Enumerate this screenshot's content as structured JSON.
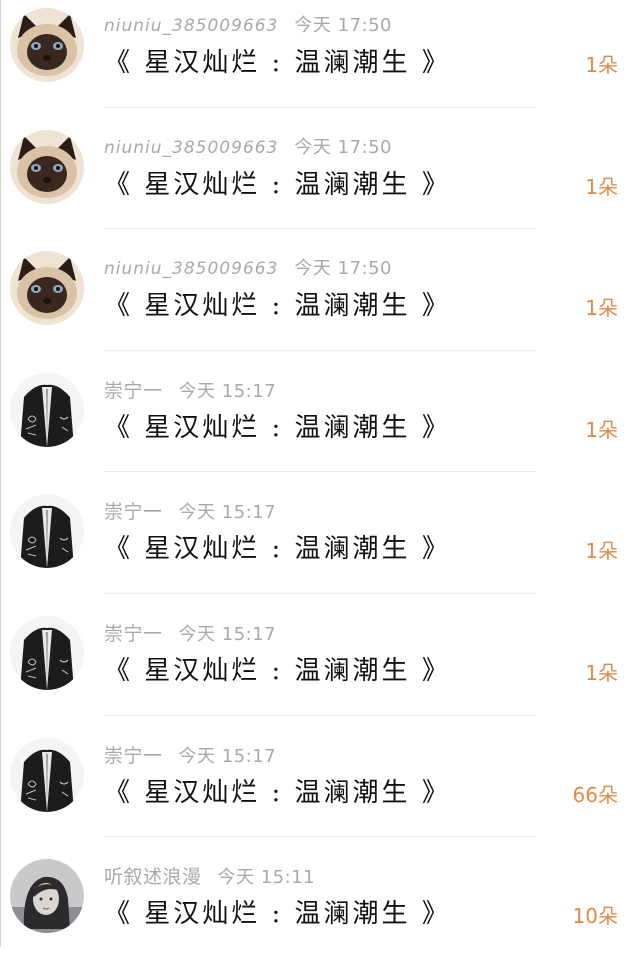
{
  "items": [
    {
      "username": "niuniu_385009663",
      "time": "今天 17:50",
      "title": "《 星汉灿烂 : 温澜潮生 》",
      "count": "1朵",
      "avatar": "cat-avatar"
    },
    {
      "username": "niuniu_385009663",
      "time": "今天 17:50",
      "title": "《 星汉灿烂 : 温澜潮生 》",
      "count": "1朵",
      "avatar": "cat-avatar"
    },
    {
      "username": "niuniu_385009663",
      "time": "今天 17:50",
      "title": "《 星汉灿烂 : 温澜潮生 》",
      "count": "1朵",
      "avatar": "cat-avatar"
    },
    {
      "username": "崇宁一",
      "time": "今天 15:17",
      "title": "《 星汉灿烂 : 温澜潮生 》",
      "count": "1朵",
      "avatar": "robe-avatar"
    },
    {
      "username": "崇宁一",
      "time": "今天 15:17",
      "title": "《 星汉灿烂 : 温澜潮生 》",
      "count": "1朵",
      "avatar": "robe-avatar"
    },
    {
      "username": "崇宁一",
      "time": "今天 15:17",
      "title": "《 星汉灿烂 : 温澜潮生 》",
      "count": "1朵",
      "avatar": "robe-avatar"
    },
    {
      "username": "崇宁一",
      "time": "今天 15:17",
      "title": "《 星汉灿烂 : 温澜潮生 》",
      "count": "66朵",
      "avatar": "robe-avatar"
    },
    {
      "username": "听叙述浪漫",
      "time": "今天 15:11",
      "title": "《 星汉灿烂 : 温澜潮生 》",
      "count": "10朵",
      "avatar": "girl-avatar"
    }
  ],
  "colors": {
    "meta": "#a9a9a9",
    "title": "#111111",
    "count": "#e08a48",
    "divider": "#ececec"
  }
}
